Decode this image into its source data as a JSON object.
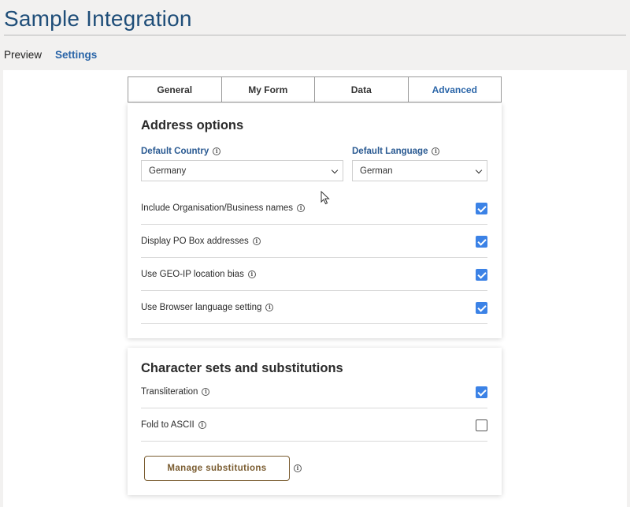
{
  "header": {
    "title": "Sample Integration"
  },
  "nav": {
    "preview": "Preview",
    "settings": "Settings"
  },
  "tabs": [
    {
      "label": "General"
    },
    {
      "label": "My Form"
    },
    {
      "label": "Data"
    },
    {
      "label": "Advanced"
    }
  ],
  "address_options": {
    "title": "Address options",
    "default_country": {
      "label": "Default Country",
      "value": "Germany"
    },
    "default_language": {
      "label": "Default Language",
      "value": "German"
    },
    "options": [
      {
        "label": "Include Organisation/Business names",
        "checked": true
      },
      {
        "label": "Display PO Box addresses",
        "checked": true
      },
      {
        "label": "Use GEO-IP location bias",
        "checked": true
      },
      {
        "label": "Use Browser language setting",
        "checked": true
      }
    ]
  },
  "character_sets": {
    "title": "Character sets and substitutions",
    "options": [
      {
        "label": "Transliteration",
        "checked": true
      },
      {
        "label": "Fold to ASCII",
        "checked": false
      }
    ],
    "manage_button": "Manage substitutions"
  },
  "icons": {
    "info": "i"
  },
  "colors": {
    "accent": "#2a65a8",
    "title": "#1f4e79",
    "checkbox": "#3b82e6",
    "button": "#7a5c30"
  }
}
